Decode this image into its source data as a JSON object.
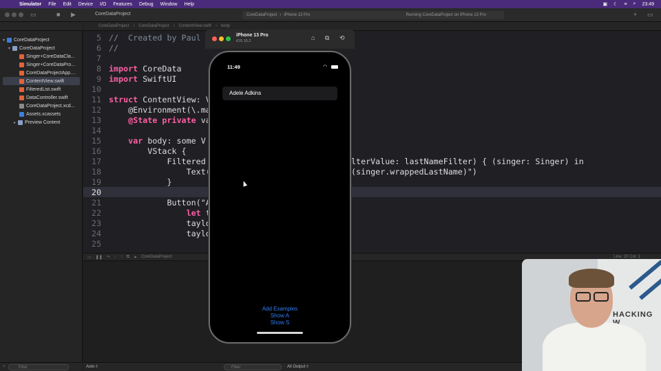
{
  "menubar": {
    "app": "Simulator",
    "items": [
      "File",
      "Edit",
      "Device",
      "I/O",
      "Features",
      "Debug",
      "Window",
      "Help"
    ],
    "clock": "23:49"
  },
  "toolbar": {
    "project": "CoreDataProject",
    "scheme": "CoreDataProject",
    "device": "iPhone 13 Pro",
    "status": "Running CoreDataProject on iPhone 13 Pro"
  },
  "navigator": {
    "items": [
      {
        "label": "CoreDataProject",
        "icon": "project-icon"
      },
      {
        "label": "CoreDataProject",
        "icon": "folder-icon"
      },
      {
        "label": "Singer+CoreDataCla...",
        "icon": "swift-file-icon"
      },
      {
        "label": "Singer+CoreDataPro...",
        "icon": "swift-file-icon"
      },
      {
        "label": "CoreDataProjectApp....",
        "icon": "swift-file-icon"
      },
      {
        "label": "ContentView.swift",
        "icon": "swift-file-icon"
      },
      {
        "label": "FilteredList.swift",
        "icon": "swift-file-icon"
      },
      {
        "label": "DataController.swift",
        "icon": "swift-file-icon"
      },
      {
        "label": "CoreDataProject.xcd...",
        "icon": "datamodel-icon"
      },
      {
        "label": "Assets.xcassets",
        "icon": "assets-icon"
      },
      {
        "label": "Preview Content",
        "icon": "folder-icon"
      }
    ],
    "filter_placeholder": "Filter"
  },
  "jumpbar": {
    "path": [
      "CoreDataProject",
      "CoreDataProject",
      "ContentView.swift",
      "body"
    ]
  },
  "editor": {
    "lines": [
      {
        "n": "5",
        "text": "//  Created by Paul"
      },
      {
        "n": "6",
        "text": "//"
      },
      {
        "n": "7",
        "text": ""
      },
      {
        "n": "8",
        "text": "import CoreData"
      },
      {
        "n": "9",
        "text": "import SwiftUI"
      },
      {
        "n": "10",
        "text": ""
      },
      {
        "n": "11",
        "text": "struct ContentView: V"
      },
      {
        "n": "12",
        "text": "    @Environment(\\.ma"
      },
      {
        "n": "13",
        "text": "    @State private va"
      },
      {
        "n": "14",
        "text": ""
      },
      {
        "n": "15",
        "text": "    var body: some V"
      },
      {
        "n": "16",
        "text": "        VStack {"
      },
      {
        "n": "17",
        "text": "            Filtered"
      },
      {
        "n": "18",
        "text": "                Text("
      },
      {
        "n": "19",
        "text": "            }"
      },
      {
        "n": "20",
        "text": ""
      },
      {
        "n": "21",
        "text": "            Button(\"A"
      },
      {
        "n": "22",
        "text": "                let t"
      },
      {
        "n": "23",
        "text": "                taylo"
      },
      {
        "n": "24",
        "text": "                taylo"
      },
      {
        "n": "25",
        "text": ""
      }
    ],
    "line17_tail": "lterValue: lastNameFilter) { (singer: Singer) in",
    "line18_tail": "(singer.wrappedLastName)\")"
  },
  "debug": {
    "target": "CoreDataProject",
    "position": "Line: 20  Col: 1"
  },
  "console": {
    "scope": "Auto ◊",
    "filter_placeholder": "Filter",
    "output": "All Output ◊"
  },
  "simulator": {
    "device_name": "iPhone 13 Pro",
    "os_version": "iOS 15.2",
    "time": "11:49",
    "list_rows": [
      "Adele Adkins"
    ],
    "buttons": [
      "Add Examples",
      "Show A",
      "Show S"
    ]
  },
  "webcam": {
    "wall_text": "HACKING W"
  }
}
